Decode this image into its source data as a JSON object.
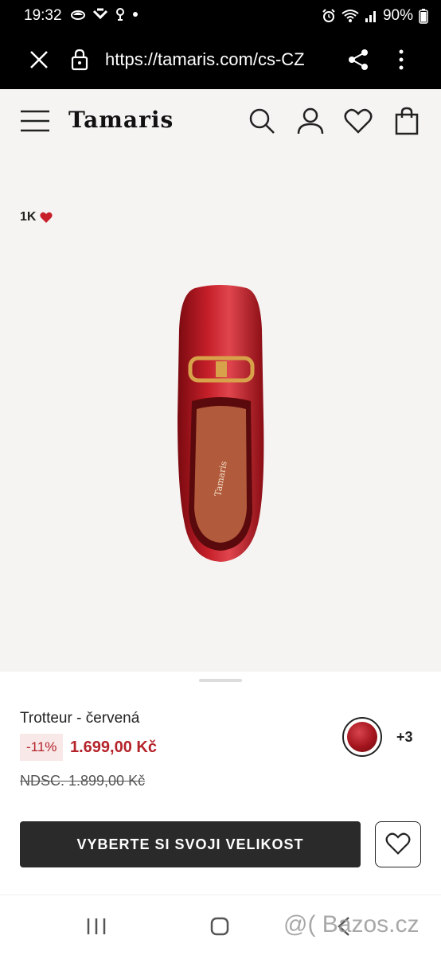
{
  "status_bar": {
    "time": "19:32",
    "left_icons": [
      "cloud-icon",
      "game-icon",
      "location-icon",
      "dot-icon"
    ],
    "right_icons": [
      "alarm-icon",
      "wifi-icon",
      "signal-icon"
    ],
    "battery": "90%"
  },
  "browser": {
    "url": "https://tamaris.com/cs-CZ"
  },
  "header": {
    "logo": "Tamaris"
  },
  "product": {
    "likes": "1K",
    "name": "Trotteur - červená",
    "discount": "-11%",
    "price": "1.699,00 Kč",
    "old_price": "NDSC. 1.899,00 Kč",
    "more_colors": "+3",
    "swatch_color": "#b5232a"
  },
  "actions": {
    "size_button": "VYBERTE SI SVOJI VELIKOST"
  },
  "watermark": "@( Bazos.cz",
  "colors": {
    "accent": "#b5232a",
    "header_bg": "#f6f4f3",
    "dark_button": "#2a2a2a"
  }
}
